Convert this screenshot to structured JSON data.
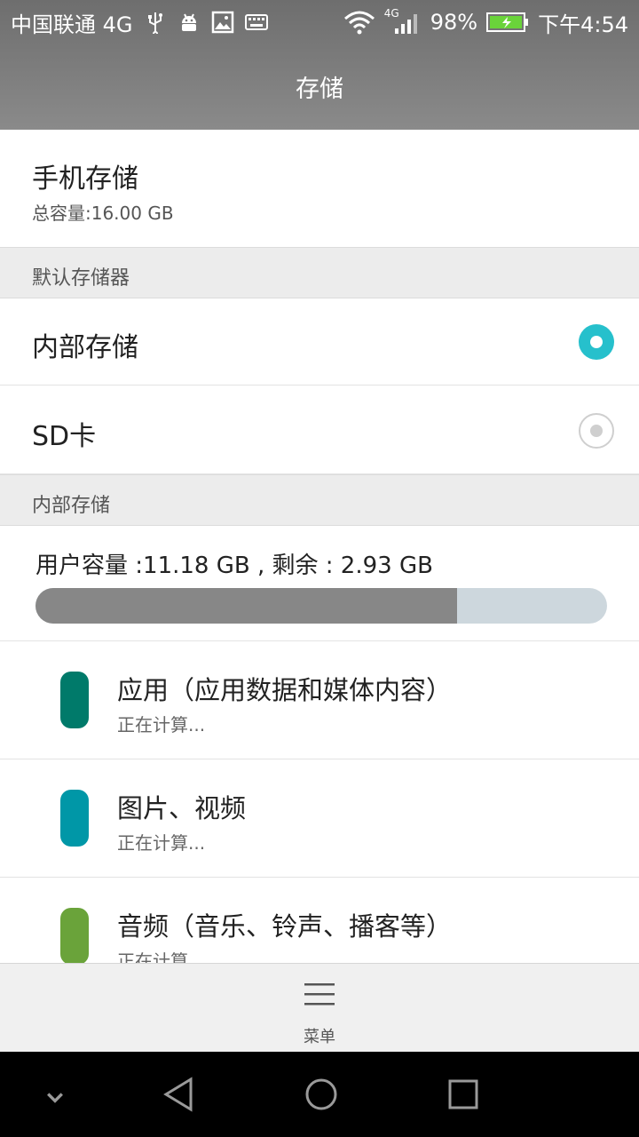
{
  "status_bar": {
    "carrier": "中国联通 4G",
    "network_badge": "4G",
    "battery": "98%",
    "time": "下午4:54",
    "icons": [
      "usb-icon",
      "android-debug-icon",
      "image-icon",
      "keyboard-icon",
      "wifi-icon",
      "signal-icon",
      "battery-icon"
    ]
  },
  "header": {
    "title": "存储"
  },
  "phone_storage": {
    "title": "手机存储",
    "total": "总容量:16.00 GB"
  },
  "default_storage": {
    "section_label": "默认存储器",
    "options": [
      {
        "label": "内部存储",
        "selected": true
      },
      {
        "label": "SD卡",
        "selected": false
      }
    ]
  },
  "internal_storage": {
    "section_label": "内部存储",
    "capacity_text": "用户容量 :11.18 GB , 剩余 : 2.93 GB",
    "used_fraction": 0.738
  },
  "categories": [
    {
      "title": "应用（应用数据和媒体内容）",
      "status": "正在计算...",
      "color": "#007a6a"
    },
    {
      "title": "图片、视频",
      "status": "正在计算...",
      "color": "#0097a7"
    },
    {
      "title": "音频（音乐、铃声、播客等）",
      "status": "正在计算...",
      "color": "#6aa33a"
    }
  ],
  "menu": {
    "label": "菜单"
  },
  "colors": {
    "accent": "#26c0cc",
    "bar_used": "#878787",
    "bar_free": "#cdd7dd"
  }
}
